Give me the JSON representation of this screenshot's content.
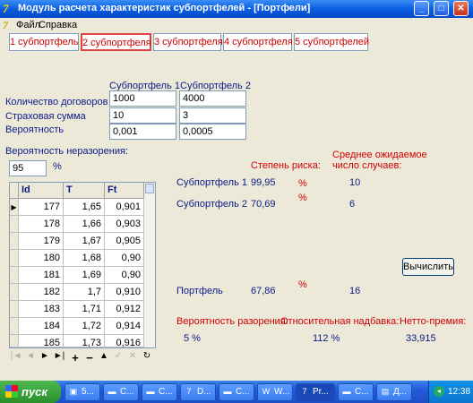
{
  "window": {
    "title": "Модуль расчета характеристик субпортфелей - [Портфели]",
    "icon": "delphi-app-icon"
  },
  "menu": {
    "items": [
      "Файл",
      "Справка"
    ]
  },
  "tabs": [
    "1 субпортфель",
    "2 субпортфеля",
    "3 субпортфеля",
    "4 субпортфеля",
    "5 субпортфелей"
  ],
  "params": {
    "col1": "Субпортфель 1",
    "col2": "Субпортфель 2",
    "rows": [
      {
        "label": "Количество договоров",
        "v1": "1000",
        "v2": "4000"
      },
      {
        "label": "Страховая сумма",
        "v1": "10",
        "v2": "3"
      },
      {
        "label": "Вероятность",
        "v1": "0,001",
        "v2": "0,0005"
      }
    ]
  },
  "survival": {
    "label": "Вероятность неразорения:",
    "value": "95",
    "unit": "%"
  },
  "table": {
    "headers": [
      "Id",
      "T",
      "Ft"
    ],
    "rows": [
      [
        "177",
        "1,65",
        "0,901"
      ],
      [
        "178",
        "1,66",
        "0,903"
      ],
      [
        "179",
        "1,67",
        "0,905"
      ],
      [
        "180",
        "1,68",
        "0,90"
      ],
      [
        "181",
        "1,69",
        "0,90"
      ],
      [
        "182",
        "1,7",
        "0,910"
      ],
      [
        "183",
        "1,71",
        "0,912"
      ],
      [
        "184",
        "1,72",
        "0,914"
      ],
      [
        "185",
        "1,73",
        "0,916"
      ]
    ]
  },
  "results": {
    "risk_header": "Степень риска:",
    "expected_header_1": "Среднее ожидаемое",
    "expected_header_2": "число случаев:",
    "rows": [
      {
        "label": "Субпортфель 1",
        "risk": "99,95",
        "unit": "%",
        "expected": "10"
      },
      {
        "label": "Субпортфель 2",
        "risk": "70,69",
        "unit": "%",
        "expected": "6"
      }
    ],
    "portfolio": {
      "label": "Портфель",
      "risk": "67,86",
      "unit": "%",
      "expected": "16"
    },
    "calc_button": "Вычислить"
  },
  "bottom": {
    "ruin_label": "Вероятность разорения:",
    "loading_label": "Относительная надбавка:",
    "premium_label": "Нетто-премия:",
    "ruin_value": "5 %",
    "loading_value": "112 %",
    "premium_value": "33,915"
  },
  "navigator": [
    "first-icon",
    "prior-icon",
    "next-icon",
    "last-icon",
    "insert-icon",
    "delete-icon",
    "edit-icon",
    "post-icon",
    "cancel-icon",
    "refresh-icon"
  ],
  "taskbar": {
    "start": "пуск",
    "items": [
      "5...",
      "C...",
      "C...",
      "D...",
      "C...",
      "W...",
      "Pr...",
      "C...",
      "Д..."
    ],
    "clock": "12:38"
  },
  "colors": {
    "accent_red": "#d00000",
    "label_blue": "#0a1a8a",
    "window_bg": "#ece9d8"
  }
}
